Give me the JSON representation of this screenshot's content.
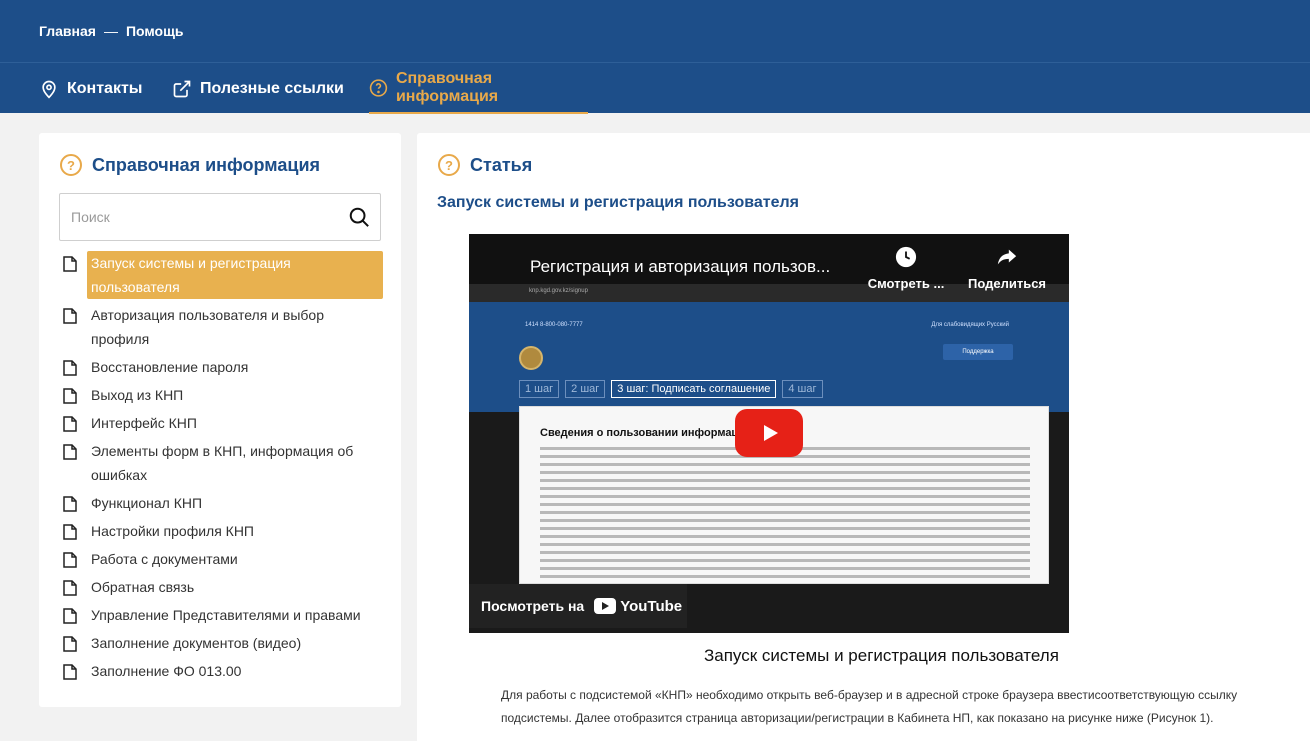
{
  "breadcrumb": {
    "home": "Главная",
    "separator": "—",
    "current": "Помощь"
  },
  "nav": {
    "contacts": "Контакты",
    "useful_links": "Полезные ссылки",
    "reference": "Справочная информация"
  },
  "sidebar": {
    "title": "Справочная информация",
    "search_placeholder": "Поиск",
    "items": [
      {
        "label": "Запуск системы и регистрация пользователя"
      },
      {
        "label": "Авторизация пользователя и выбор профиля"
      },
      {
        "label": "Восстановление пароля"
      },
      {
        "label": "Выход из КНП"
      },
      {
        "label": "Интерфейс КНП"
      },
      {
        "label": "Элементы форм в КНП, информация об ошибках"
      },
      {
        "label": "Функционал КНП"
      },
      {
        "label": "Настройки профиля КНП"
      },
      {
        "label": "Работа с документами"
      },
      {
        "label": "Обратная связь"
      },
      {
        "label": "Управление Представителями и правами"
      },
      {
        "label": "Заполнение документов (видео)"
      },
      {
        "label": "Заполнение ФО 013.00"
      }
    ]
  },
  "content": {
    "title": "Статья",
    "heading": "Запуск системы и регистрация пользователя",
    "video": {
      "title": "Регистрация и авторизация пользов...",
      "watch_later": "Смотреть ...",
      "share": "Поделиться",
      "watch_on": "Посмотреть на",
      "youtube": "YouTube",
      "url": "knp.kgd.gov.kz/signup",
      "phone": "1414   8-800-080-7777",
      "accessibility": "Для слабовидящих   Русский",
      "support": "Поддержка",
      "steps": [
        "1 шаг",
        "2 шаг",
        "3 шаг: Подписать соглашение",
        "4 шаг"
      ],
      "doc_heading": "Сведения о пользовании информационн"
    },
    "caption": "Запуск системы и регистрация пользователя",
    "body": "Для работы с подсистемой «КНП» необходимо открыть веб-браузер и в адресной строке браузера ввестисоответствующую ссылку подсистемы. Далее отобразится страница авторизации/регистрации в Кабинета НП, как показано на рисунке ниже (Рисунок 1)."
  },
  "colors": {
    "primary": "#1d4e89",
    "accent": "#e8a94a",
    "active_item": "#e8b14f"
  }
}
